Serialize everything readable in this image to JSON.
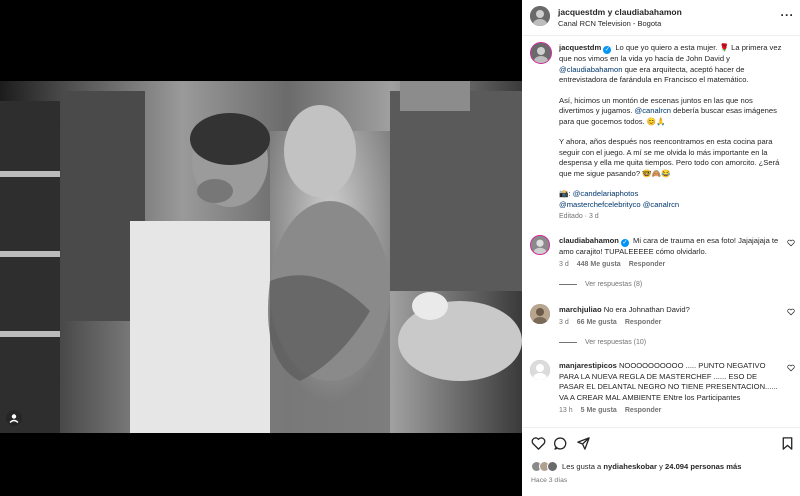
{
  "post": {
    "header": {
      "usernames": "jacquestdm y claudiabahamon",
      "location": "Canal RCN Television - Bogota"
    },
    "caption": {
      "username": "jacquestdm",
      "p1_a": " Lo que yo quiero a esta mujer. 🌹 La primera vez que nos vimos en la vida yo hacía de John David y ",
      "p1_mention": "@claudiabahamon",
      "p1_b": " que era arquitecta, aceptó hacer de entrevistadora de farándula en Francisco el matemático.",
      "p2_a": "Así, hicimos un montón de escenas juntos en las que nos divertimos y jugamos. ",
      "p2_mention": "@canalrcn",
      "p2_b": " debería buscar esas imágenes para que gocemos todos. 😊🙏",
      "p3": "Y ahora, años después nos reencontramos en esta cocina para seguir con el juego. A mí se me olvida lo más importante en la despensa y ella me quita tiempos. Pero todo con amorcito. ¿Será que me sigue pasando? 🤓🙈😂",
      "p4_a": "📸: ",
      "p4_mention1": "@candelariaphotos",
      "p4_mention2": "@masterchefcelebrityco",
      "p4_mention3": "@canalrcn",
      "edited": "Editado · 3 d"
    },
    "comments": [
      {
        "username": "claudiabahamon",
        "text": " Mi cara de trauma en esa foto! Jajajajaja te amo carajito! TUPALEEEEE cómo olvidarlo.",
        "time": "3 d",
        "likes": "448 Me gusta",
        "reply": "Responder",
        "view_replies": "Ver respuestas (8)"
      },
      {
        "username": "marchjuliao",
        "text": " No era Johnathan David?",
        "time": "3 d",
        "likes": "66 Me gusta",
        "reply": "Responder",
        "view_replies": "Ver respuestas (10)"
      },
      {
        "username": "manjarestipicos",
        "text": " NOOOOOOOOOO ..... PUNTO NEGATIVO PARA LA NUEVA REGLA DE MASTERCHEF ...... ESO DE PASAR EL DELANTAL NEGRO NO TIENE PRESENTACION...... VA A CREAR MAL AMBIENTE ENtre los Participantes",
        "time": "13 h",
        "likes": "5 Me gusta",
        "reply": "Responder"
      }
    ],
    "likes": {
      "prefix": "Les gusta a ",
      "user": "nydiaheskobar",
      "middle": " y ",
      "count": "24.094 personas más"
    },
    "time_ago": "Hace 3 días"
  },
  "icons": {
    "like": "heart-icon",
    "comment": "comment-icon",
    "share": "share-icon",
    "save": "bookmark-icon",
    "tag": "user-tag-icon",
    "more": "more-options-icon"
  },
  "colors": {
    "accent": "#0095f6",
    "mention": "#00376b",
    "muted": "#737373",
    "text": "#262626"
  }
}
